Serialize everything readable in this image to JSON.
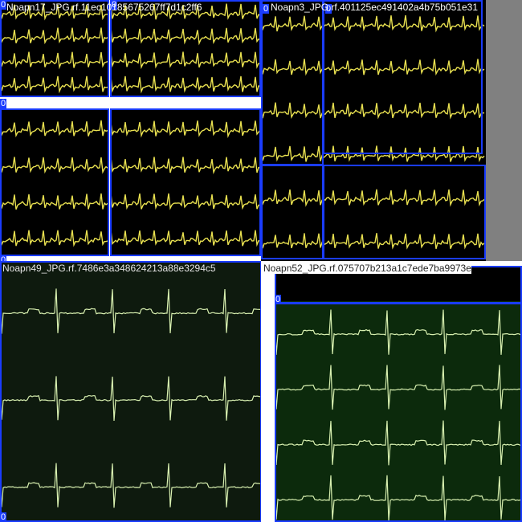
{
  "tiles": [
    {
      "title": "Noapn17_JPG.rf.11ec10185675267ff7d1c2ff6",
      "box_label": "0"
    },
    {
      "title": "Noapn3_JPG.rf.401125ec491402a4b75b051e31",
      "box_label": "0"
    },
    {
      "title": "Noapn49_JPG.rf.7486e3a348624213a88e3294c5",
      "box_label": "0"
    },
    {
      "title": "Noapn52_JPG.rf.075707b213a1c7ede7ba9973e",
      "box_label": "0"
    }
  ],
  "colors": {
    "box": "#1a3cff",
    "trace_yellow": "#e8e050",
    "trace_green": "#d8f0b0",
    "bg_dark_green": "#0e1a0e",
    "bg_green": "#0c2a0c",
    "gray": "#808080"
  }
}
